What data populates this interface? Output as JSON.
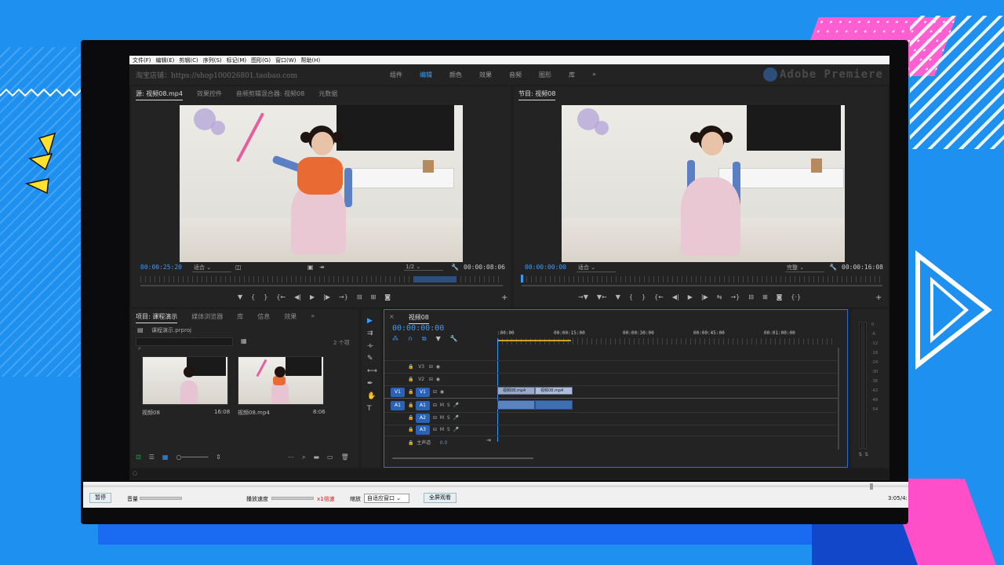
{
  "menu": [
    "文件(F)",
    "编辑(E)",
    "剪辑(C)",
    "序列(S)",
    "标记(M)",
    "图形(G)",
    "窗口(W)",
    "帮助(H)"
  ],
  "workspace": {
    "shop_text": "淘宝店铺：https://shop100026801.taobao.com",
    "tabs": [
      "组件",
      "编辑",
      "颜色",
      "效果",
      "音频",
      "图形",
      "库",
      "»"
    ],
    "active_tab": "编辑",
    "brand": "Adobe Premiere"
  },
  "source_panel": {
    "tabs": [
      "源: 视频08.mp4",
      "效果控件",
      "音频剪辑混合器: 视频08",
      "元数据"
    ],
    "timecode_in": "00:00:25:20",
    "fit": "适合",
    "quality": "1/2",
    "duration": "00:00:08:06"
  },
  "program_panel": {
    "tabs": [
      "节目: 视频08"
    ],
    "timecode_in": "00:00:00:00",
    "fit": "适合",
    "quality": "完整",
    "duration": "00:00:16:08"
  },
  "project_panel": {
    "tabs": [
      "项目: 课程演示",
      "媒体浏览器",
      "库",
      "信息",
      "效果",
      "»"
    ],
    "file": "课程演示.prproj",
    "item_count": "2 个项",
    "items": [
      {
        "name": "视频08",
        "duration": "16:08"
      },
      {
        "name": "视频08.mp4",
        "duration": "8:06"
      }
    ]
  },
  "timeline": {
    "tab": "视频08",
    "timecode": "00:00:00:00",
    "ruler_labels": [
      ":00:00",
      "00:00:15:00",
      "00:00:30:00",
      "00:00:45:00",
      "00:01:00:00"
    ],
    "video_tracks": [
      "V3",
      "V2",
      "V1"
    ],
    "audio_tracks": [
      "A1",
      "A2",
      "A3"
    ],
    "master": "主声道",
    "master_value": "0.0",
    "clips": [
      "视频08.mp4",
      "视频08.mp4"
    ]
  },
  "meters": {
    "scale": [
      "0",
      "-6",
      "-12",
      "-18",
      "-24",
      "-30",
      "-36",
      "-42",
      "-48",
      "-54"
    ],
    "solo": [
      "S",
      "S"
    ]
  },
  "player": {
    "pause": "暂停",
    "volume_label": "音量",
    "speed_label": "播放速度",
    "speed_value": "x1倍速",
    "zoom_label": "缩放",
    "zoom_value": "自适应窗口",
    "fullscreen": "全屏观看",
    "time": "3:05/4:"
  }
}
